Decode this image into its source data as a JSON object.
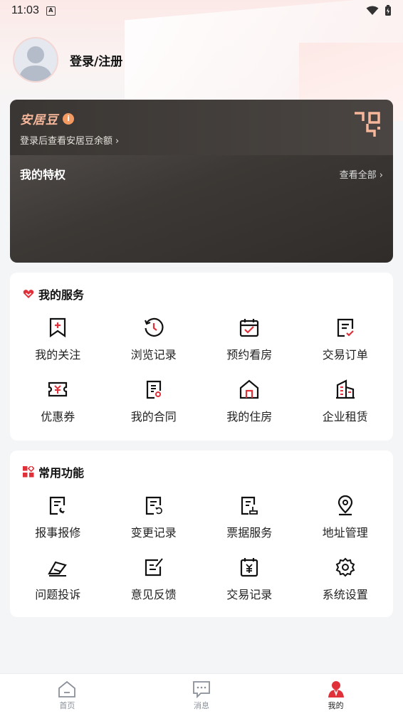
{
  "status_bar": {
    "time": "11:03",
    "notif_badge": "A"
  },
  "profile": {
    "login_label": "登录/注册"
  },
  "bean_card": {
    "title": "安居豆",
    "info_icon": "i",
    "subtitle": "登录后查看安居豆余额",
    "chevron": "›",
    "privilege_title": "我的特权",
    "view_all": "查看全部",
    "view_all_chevron": "›"
  },
  "services": {
    "title": "我的服务",
    "items": [
      {
        "label": "我的关注",
        "icon": "bookmark-icon"
      },
      {
        "label": "浏览记录",
        "icon": "history-icon"
      },
      {
        "label": "预约看房",
        "icon": "calendar-check-icon"
      },
      {
        "label": "交易订单",
        "icon": "order-icon"
      },
      {
        "label": "优惠券",
        "icon": "coupon-icon"
      },
      {
        "label": "我的合同",
        "icon": "contract-icon"
      },
      {
        "label": "我的住房",
        "icon": "house-icon"
      },
      {
        "label": "企业租赁",
        "icon": "building-icon"
      }
    ]
  },
  "functions": {
    "title": "常用功能",
    "items": [
      {
        "label": "报事报修",
        "icon": "repair-icon"
      },
      {
        "label": "变更记录",
        "icon": "change-record-icon"
      },
      {
        "label": "票据服务",
        "icon": "receipt-icon"
      },
      {
        "label": "地址管理",
        "icon": "location-icon"
      },
      {
        "label": "问题投诉",
        "icon": "complaint-icon"
      },
      {
        "label": "意见反馈",
        "icon": "feedback-icon"
      },
      {
        "label": "交易记录",
        "icon": "transaction-icon"
      },
      {
        "label": "系统设置",
        "icon": "settings-icon"
      }
    ]
  },
  "tabbar": {
    "tabs": [
      {
        "label": "首页",
        "icon": "home-icon"
      },
      {
        "label": "消息",
        "icon": "message-icon"
      },
      {
        "label": "我的",
        "icon": "profile-icon",
        "active": true
      }
    ]
  },
  "colors": {
    "accent": "#e0313b",
    "bean_gold": "#f6b79a",
    "card_dark": "#3c3835"
  }
}
